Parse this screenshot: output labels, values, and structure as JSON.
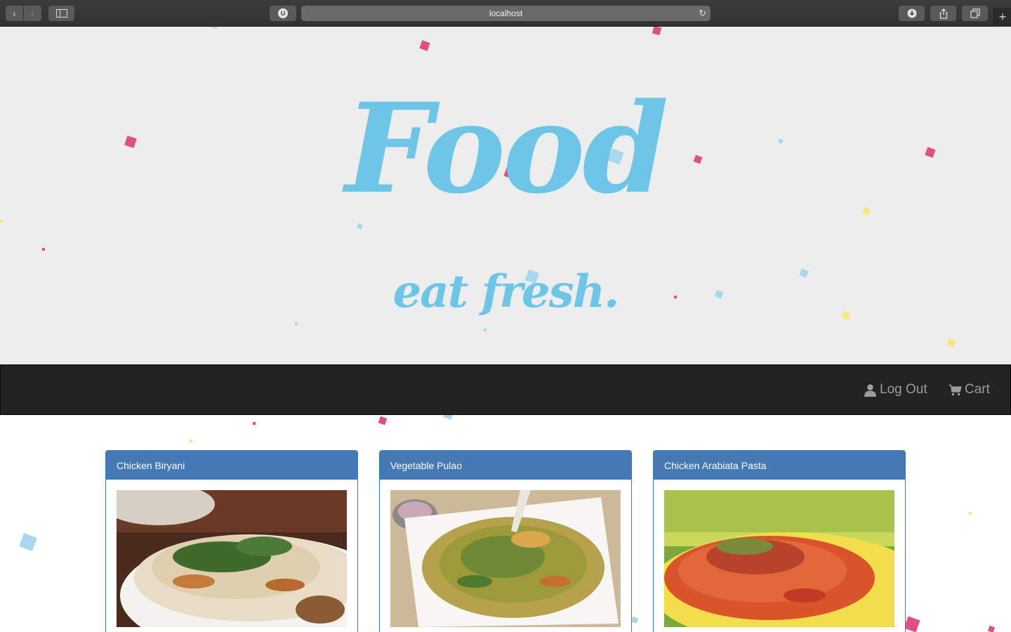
{
  "browser": {
    "url": "localhost",
    "extension_badge": "U",
    "icons": [
      "chevron-left-icon",
      "chevron-right-icon",
      "sidebar-icon",
      "reload-icon",
      "download-icon",
      "share-icon",
      "tabs-icon",
      "plus-icon"
    ]
  },
  "hero": {
    "title": "Food",
    "subtitle": "eat fresh.",
    "color": "#6ec6e6",
    "confetti_colors": [
      "#e0507f",
      "#a8d8f0",
      "#f5e97a"
    ]
  },
  "nav": {
    "logout_label": "Log Out",
    "cart_label": "Cart"
  },
  "products": [
    {
      "name": "Chicken Biryani"
    },
    {
      "name": "Vegetable Pulao"
    },
    {
      "name": "Chicken Arabiata Pasta"
    }
  ]
}
